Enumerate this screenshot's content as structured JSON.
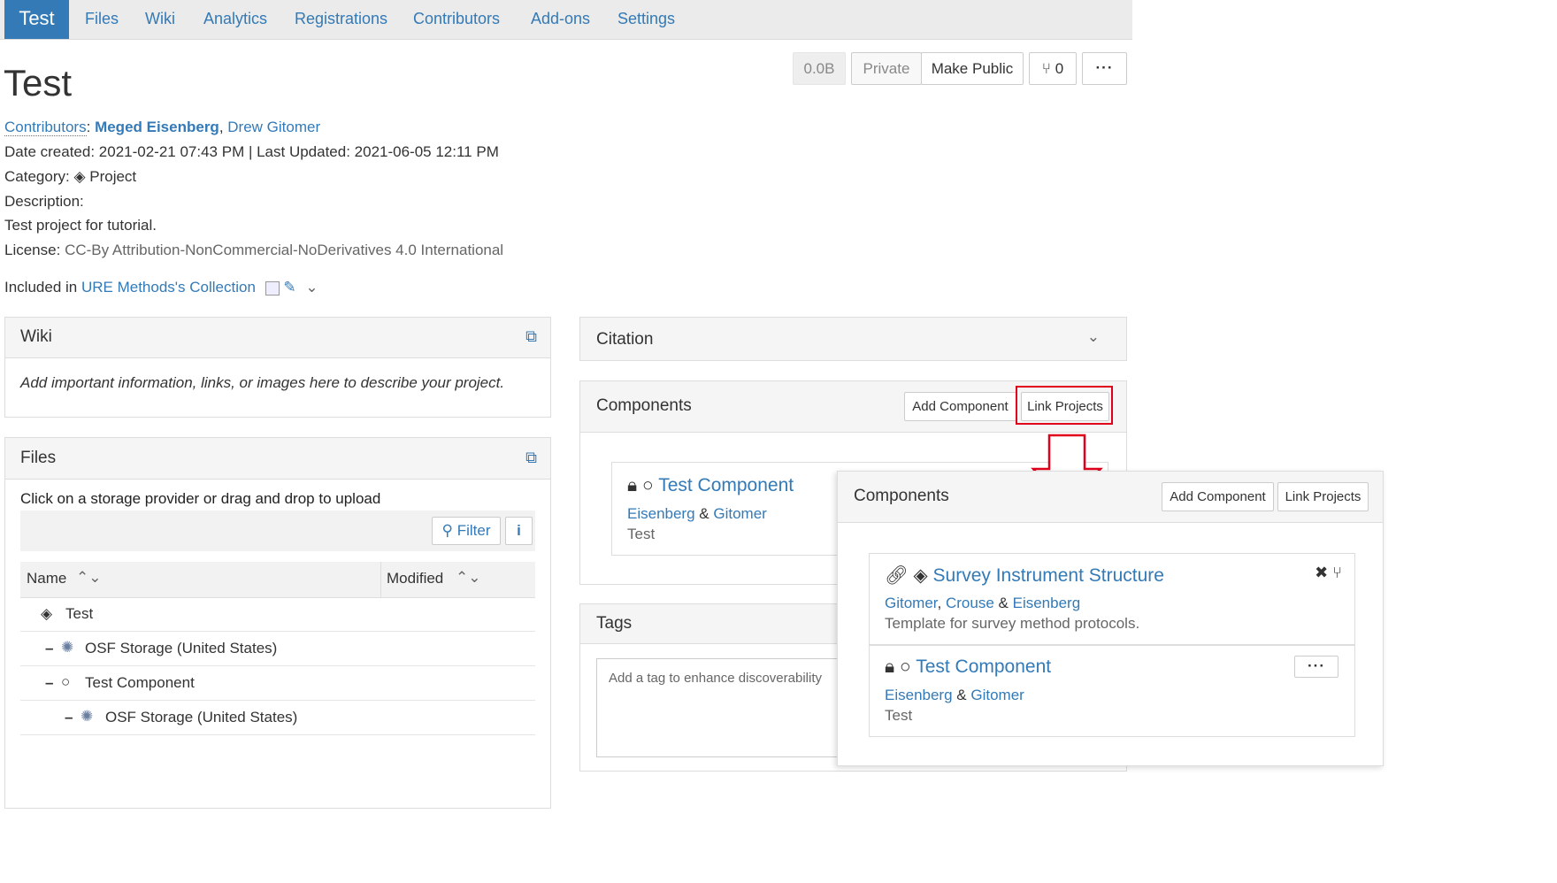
{
  "nav": {
    "brand": "Test",
    "tabs": [
      "Files",
      "Wiki",
      "Analytics",
      "Registrations",
      "Contributors",
      "Add-ons",
      "Settings"
    ]
  },
  "header": {
    "title": "Test",
    "size_label": "0.0B",
    "privacy_label": "Private",
    "make_public_label": "Make Public",
    "fork_count": "0",
    "more_label": "···"
  },
  "meta": {
    "contributors_label": "Contributors",
    "contributor_1": "Meged Eisenberg",
    "contributor_2": "Drew Gitomer",
    "dates": "Date created: 2021-02-21 07:43 PM | Last Updated: 2021-06-05 12:11 PM",
    "category_label": "Category:",
    "category_value": "Project",
    "description_label": "Description:",
    "description_value": "Test project for tutorial.",
    "license_label": "License:",
    "license_value": "CC-By Attribution-NonCommercial-NoDerivatives 4.0 International",
    "included_label": "Included in",
    "collection_name": "URE Methods's Collection"
  },
  "wiki": {
    "title": "Wiki",
    "placeholder": "Add important information, links, or images here to describe your project."
  },
  "files": {
    "title": "Files",
    "instructions": "Click on a storage provider or drag and drop to upload",
    "filter_label": "Filter",
    "col_name": "Name",
    "col_modified": "Modified",
    "rows": [
      "Test",
      "OSF Storage (United States)",
      "Test Component",
      "OSF Storage (United States)"
    ]
  },
  "citation": {
    "title": "Citation"
  },
  "components": {
    "title": "Components",
    "add_label": "Add Component",
    "link_label": "Link Projects",
    "item": {
      "name": "Test Component",
      "author_1": "Eisenberg",
      "amp": "&",
      "author_2": "Gitomer",
      "desc": "Test"
    }
  },
  "tags": {
    "title": "Tags",
    "placeholder": "Add a tag to enhance discoverability"
  },
  "overlay": {
    "title": "Components",
    "add_label": "Add Component",
    "link_label": "Link Projects",
    "item1": {
      "name": "Survey Instrument Structure",
      "author_1": "Gitomer",
      "author_2": "Crouse",
      "amp": "&",
      "author_3": "Eisenberg",
      "desc": "Template for survey method protocols."
    },
    "item2": {
      "name": "Test Component",
      "author_1": "Eisenberg",
      "amp": "&",
      "author_2": "Gitomer",
      "desc": "Test"
    }
  },
  "colors": {
    "link": "#337ab7",
    "highlight": "#e0001b",
    "nav_bg": "#ebebeb"
  }
}
